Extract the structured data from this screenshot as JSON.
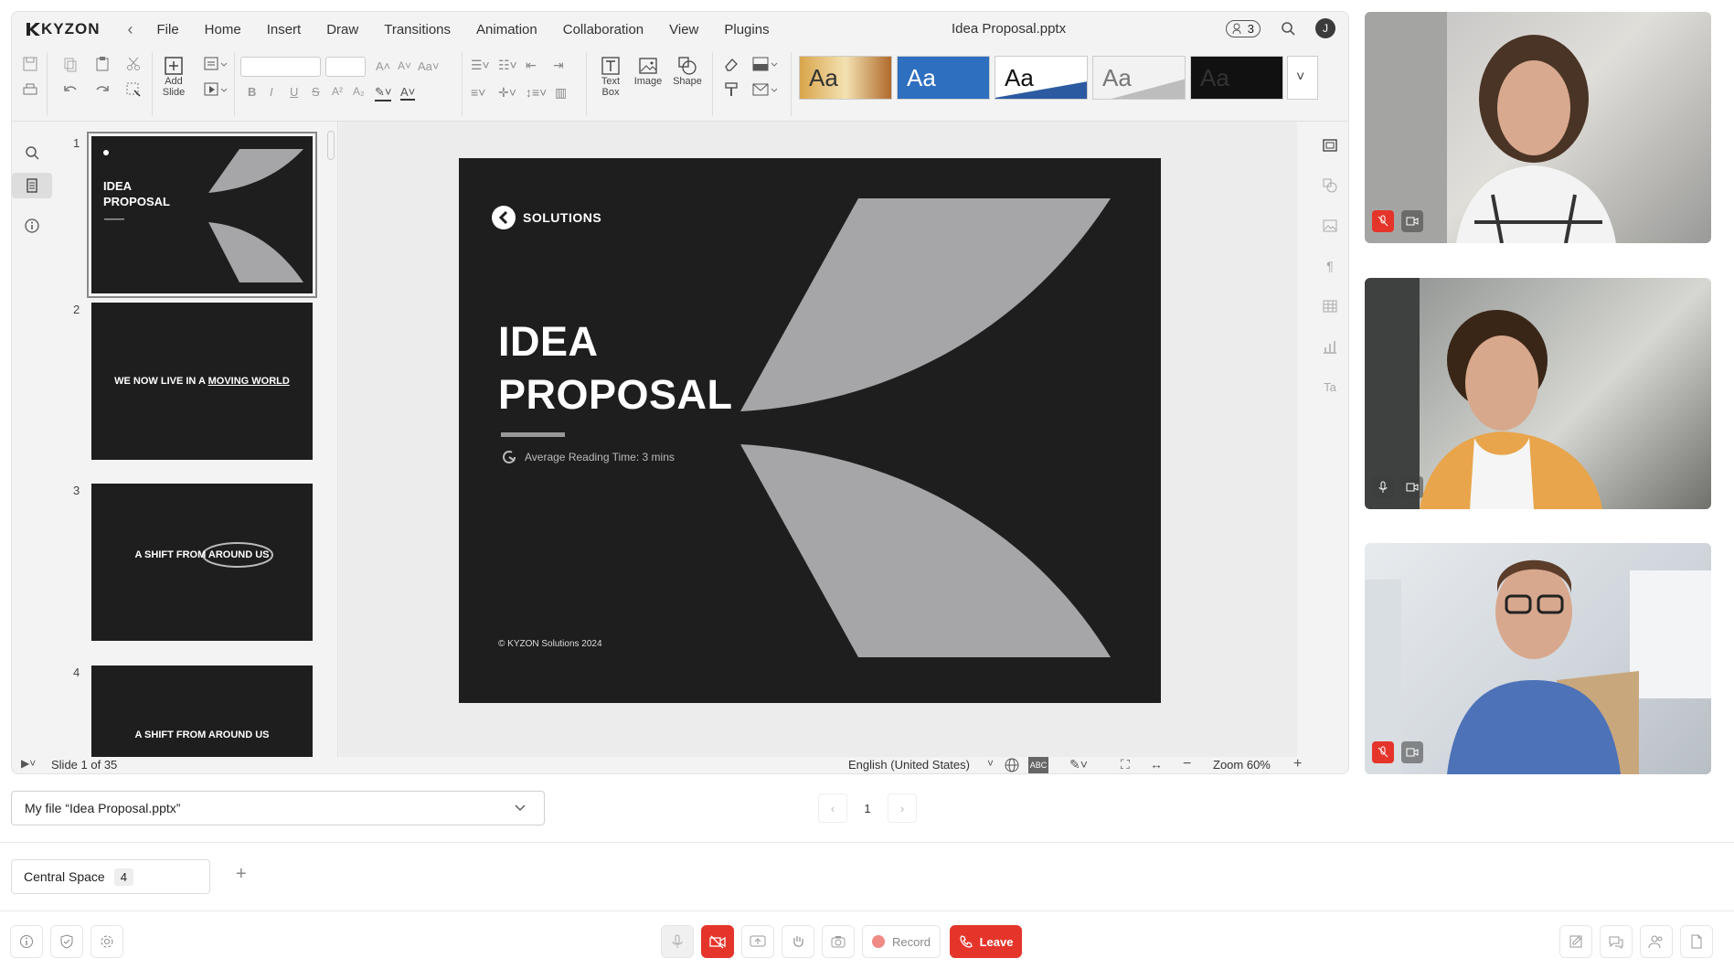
{
  "app": {
    "logo_text": "KYZON",
    "doc_title": "Idea Proposal.pptx",
    "collab_count": "3",
    "user_initial": "J"
  },
  "menu": [
    "File",
    "Home",
    "Insert",
    "Draw",
    "Transitions",
    "Animation",
    "Collaboration",
    "View",
    "Plugins"
  ],
  "toolbar": {
    "add_slide_label": "Add Slide",
    "text_box_label": "Text Box",
    "image_label": "Image",
    "shape_label": "Shape",
    "themes": [
      "Aa",
      "Aa",
      "Aa",
      "Aa",
      "Aa"
    ],
    "theme_colors": [
      "#c9a050",
      "#2f6fbf",
      "#ffffff",
      "#e8e8e8",
      "#111111"
    ]
  },
  "slides": [
    {
      "num": "1",
      "text": "IDEA PROPOSAL"
    },
    {
      "num": "2",
      "text": "WE NOW LIVE IN A MOVING WORLD"
    },
    {
      "num": "3",
      "text": "A SHIFT FROM AROUND US"
    },
    {
      "num": "4",
      "text": "A SHIFT FROM AROUND US"
    }
  ],
  "slide": {
    "logo_text": "SOLUTIONS",
    "title_line1": "IDEA",
    "title_line2": "PROPOSAL",
    "reading_time": "Average Reading Time: 3 mins",
    "copyright": "© KYZON Solutions 2024",
    "leaf_color": "#a6a6a9",
    "bg_color": "#1e1e1e"
  },
  "status": {
    "slide_counter": "Slide 1 of 35",
    "language": "English (United States)",
    "zoom": "Zoom 60%"
  },
  "file_select": {
    "label": "My file “Idea Proposal.pptx”"
  },
  "pager": {
    "page": "1"
  },
  "space_tab": {
    "label": "Central Space",
    "count": "4"
  },
  "controls": {
    "record_label": "Record",
    "leave_label": "Leave",
    "accent": "#e5352b"
  }
}
